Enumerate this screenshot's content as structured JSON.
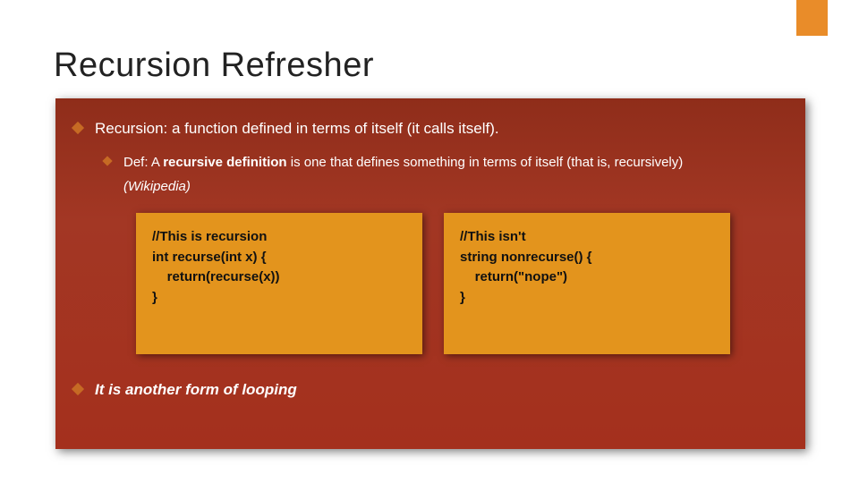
{
  "title": "Recursion Refresher",
  "bullets": {
    "point1": "Recursion: a function defined in terms of itself (it calls itself).",
    "def_prefix": "Def: A ",
    "def_bold": "recursive definition",
    "def_suffix": " is one that defines something in terms of itself (that is, recursively)",
    "def_source": "(Wikipedia)",
    "point2": "It is another form of looping"
  },
  "code": {
    "left": "//This is recursion\nint recurse(int x) {\n    return(recurse(x))\n}",
    "right": "//This isn't\nstring nonrecurse() {\n    return(\"nope\")\n}"
  },
  "colors": {
    "accent": "#e98c29",
    "panel_bg": "#9c3521",
    "code_bg": "#e3941d",
    "diamond": "#c66a24"
  }
}
